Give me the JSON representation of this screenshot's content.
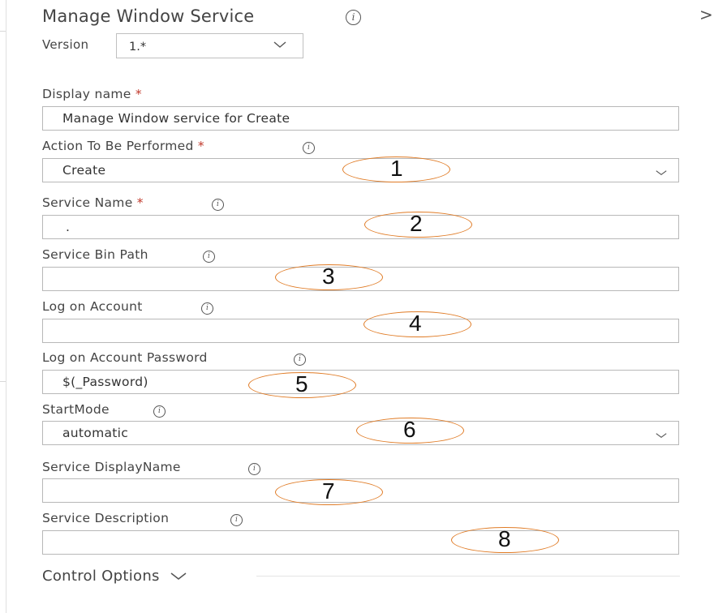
{
  "panel": {
    "title": "Manage Window Service",
    "version_label": "Version",
    "version_value": "1.*"
  },
  "fields": [
    {
      "label": "Display name",
      "required": true,
      "value": "Manage Window service for Create"
    },
    {
      "label": "Action To Be Performed",
      "required": true,
      "value": "Create",
      "type": "dropdown"
    },
    {
      "label": "Service Name",
      "required": true,
      "value": "."
    },
    {
      "label": "Service Bin Path",
      "required": false,
      "value": ""
    },
    {
      "label": "Log on Account",
      "required": false,
      "value": ""
    },
    {
      "label": "Log on Account Password",
      "required": false,
      "value": "$(_Password)"
    },
    {
      "label": "StartMode",
      "required": false,
      "value": "automatic",
      "type": "dropdown"
    },
    {
      "label": "Service DisplayName",
      "required": false,
      "value": ""
    },
    {
      "label": "Service Description",
      "required": false,
      "value": ""
    }
  ],
  "annotations": [
    "1",
    "2",
    "3",
    "4",
    "5",
    "6",
    "7",
    "8"
  ],
  "control_options": "Control Options",
  "required_marker": "*",
  "info_glyph": "i",
  "icons": {
    "info": "info-icon",
    "dropdown": "chevron-down-icon",
    "collapse": "chevron-right-icon"
  },
  "colors": {
    "annotation_oval": "#e07b25",
    "required": "#c0392b"
  }
}
